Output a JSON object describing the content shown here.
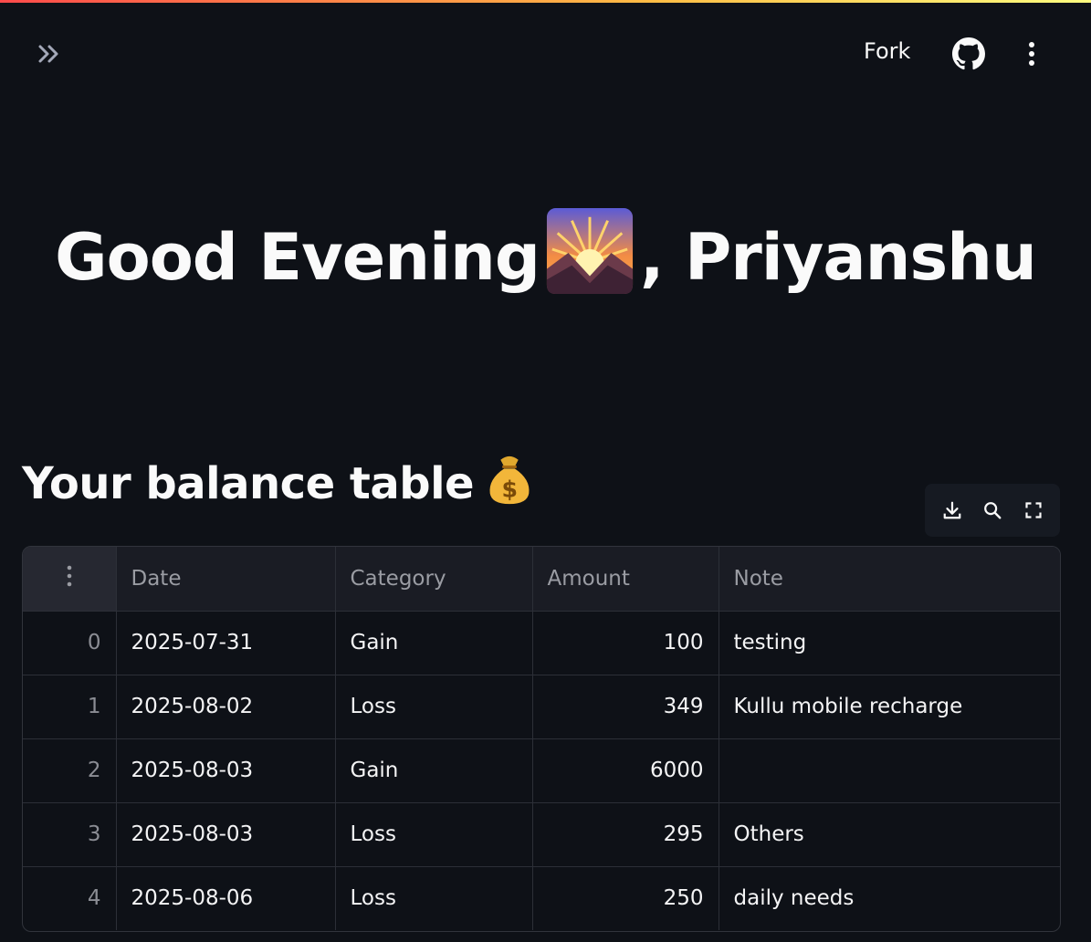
{
  "header": {
    "fork_label": "Fork",
    "icons": [
      "expand-sidebar-icon",
      "github-icon",
      "more-vertical-icon"
    ]
  },
  "greeting": {
    "prefix": "Good Evening",
    "suffix": ", Priyanshu",
    "emoji": "sunrise-over-mountains-emoji"
  },
  "balance": {
    "title": "Your balance table",
    "emoji": "money-bag-emoji",
    "toolbar": [
      "download-icon",
      "search-icon",
      "fullscreen-icon"
    ],
    "columns": [
      "Date",
      "Category",
      "Amount",
      "Note"
    ],
    "rows": [
      {
        "index": "0",
        "date": "2025-07-31",
        "category": "Gain",
        "amount": "100",
        "note": "testing"
      },
      {
        "index": "1",
        "date": "2025-08-02",
        "category": "Loss",
        "amount": "349",
        "note": "Kullu mobile recharge"
      },
      {
        "index": "2",
        "date": "2025-08-03",
        "category": "Gain",
        "amount": "6000",
        "note": ""
      },
      {
        "index": "3",
        "date": "2025-08-03",
        "category": "Loss",
        "amount": "295",
        "note": "Others"
      },
      {
        "index": "4",
        "date": "2025-08-06",
        "category": "Loss",
        "amount": "250",
        "note": "daily needs"
      }
    ]
  },
  "colors": {
    "background": "#0e1117",
    "accent_gradient_start": "#ff4b4b",
    "accent_gradient_end": "#fffd80",
    "text": "#fafafa"
  }
}
